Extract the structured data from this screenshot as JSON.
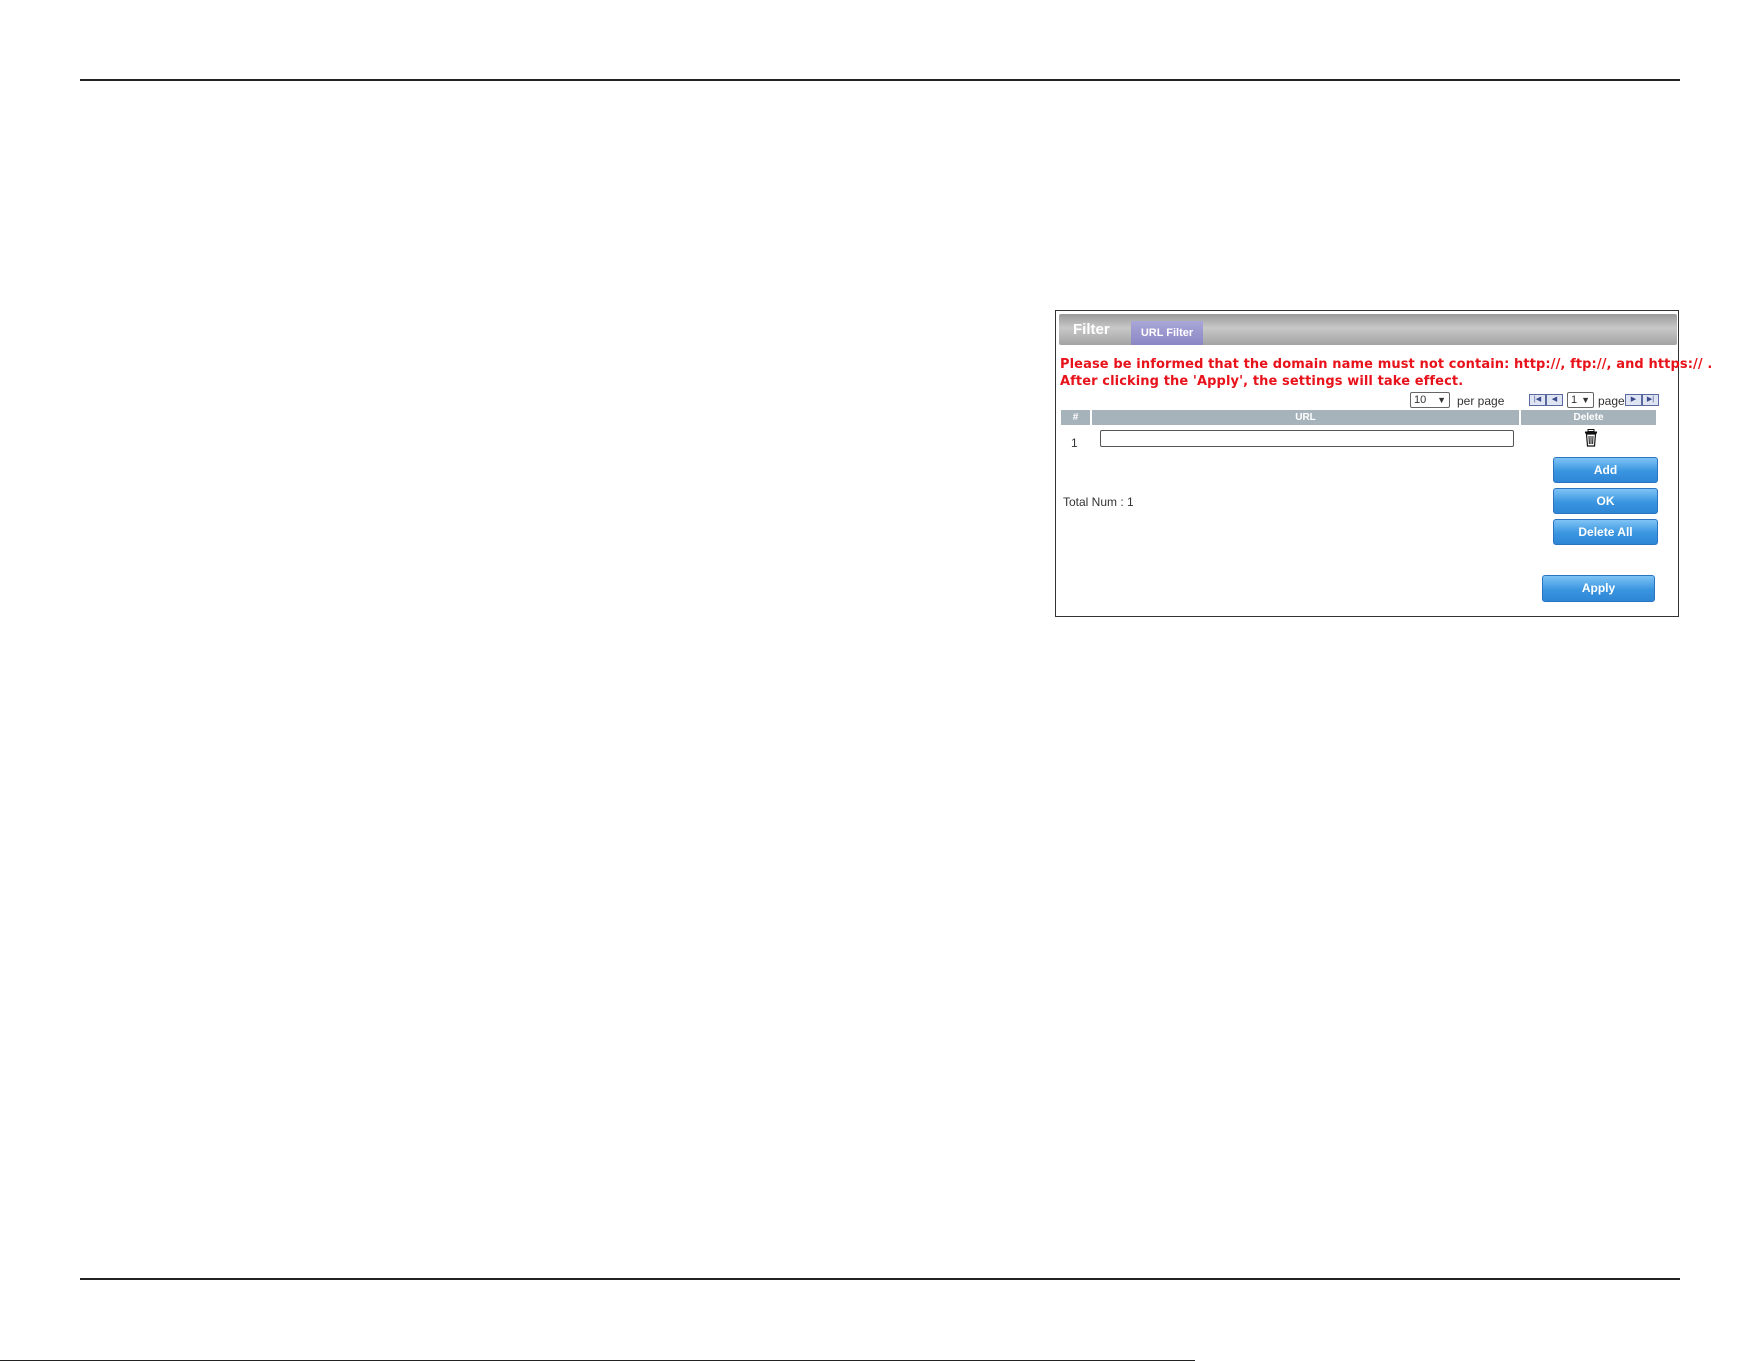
{
  "panel": {
    "title": "Filter",
    "tab_label": "URL Filter",
    "notice_line1": "Please be informed that the domain name must not contain: http://, ftp://, and https:// .",
    "notice_line2": "After clicking the 'Apply', the settings will take effect."
  },
  "pager": {
    "per_page_value": "10",
    "per_page_label": "per page",
    "page_value": "1",
    "page_label": "page",
    "first_icon": "first-page-icon",
    "prev_icon": "prev-page-icon",
    "next_icon": "next-page-icon",
    "last_icon": "last-page-icon"
  },
  "table": {
    "headers": {
      "num": "#",
      "url": "URL",
      "delete": "Delete"
    },
    "rows": [
      {
        "num": "1",
        "url": ""
      }
    ]
  },
  "buttons": {
    "add": "Add",
    "ok": "OK",
    "delete_all": "Delete All",
    "apply": "Apply"
  },
  "total": {
    "label": "Total Num :",
    "value": "1"
  },
  "colors": {
    "notice": "#e8121a",
    "tab": "#8a87c5",
    "header_bar": "#a6b3bb",
    "button": "#3a95e0"
  }
}
